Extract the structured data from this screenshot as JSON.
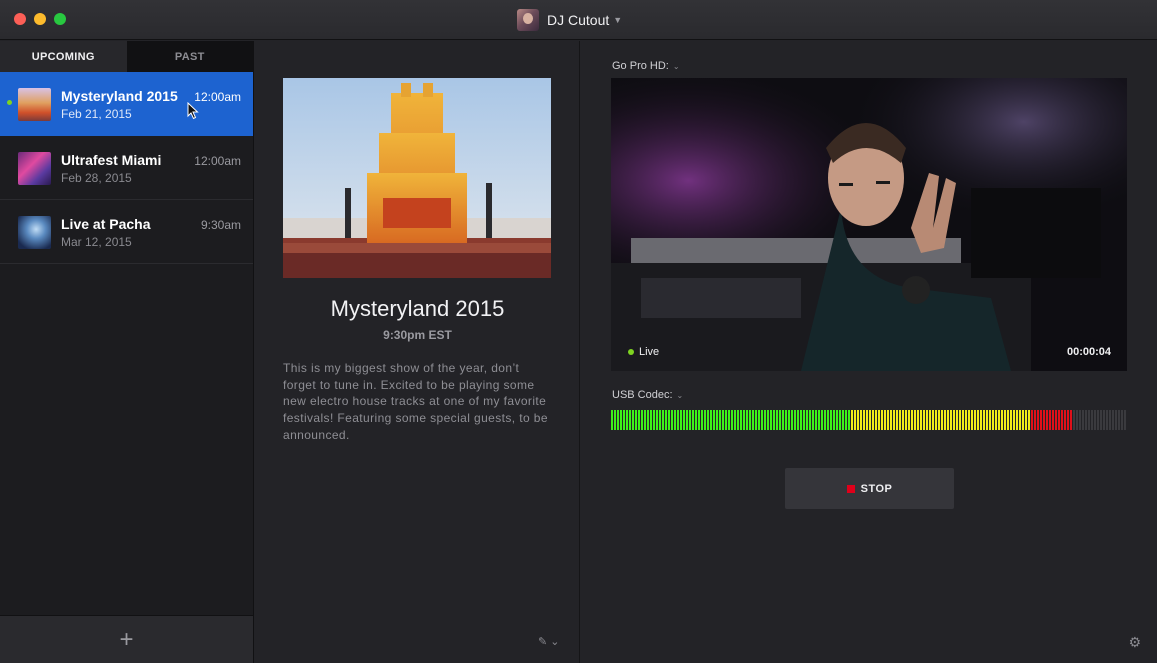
{
  "titlebar": {
    "profile_name": "DJ Cutout",
    "caret_icon": "chevron-down-icon"
  },
  "sidebar": {
    "tabs": [
      {
        "label": "UPCOMING",
        "selected": true
      },
      {
        "label": "PAST",
        "selected": false
      }
    ],
    "events": [
      {
        "title": "Mysteryland 2015",
        "date": "Feb 21, 2015",
        "time": "12:00am",
        "selected": true,
        "live": true
      },
      {
        "title": "Ultrafest Miami",
        "date": "Feb 28, 2015",
        "time": "12:00am",
        "selected": false,
        "live": false
      },
      {
        "title": "Live at Pacha",
        "date": "Mar 12, 2015",
        "time": "9:30am",
        "selected": false,
        "live": false
      }
    ],
    "add_icon": "plus-icon",
    "add_glyph": "+"
  },
  "detail": {
    "title": "Mysteryland 2015",
    "time": "9:30pm EST",
    "description": "This is my biggest show of the year, don’t forget to tune in. Excited to be playing some new electro house tracks at one of my favorite festivals! Featuring some special guests, to be announced.",
    "edit_icon": "pencil-icon",
    "edit_glyph": "✎ ⌄"
  },
  "stream": {
    "video_source_label": "Go Pro HD:",
    "audio_source_label": "USB Codec:",
    "caret_glyph": "⌄",
    "live_label": "Live",
    "timer": "00:00:04",
    "stop_label": "STOP",
    "settings_icon": "gear-icon",
    "settings_glyph": "⚙",
    "audio_level": 0.89,
    "meter_zones": {
      "green_until": 0.46,
      "yellow_until": 0.81,
      "red_until": 0.89
    },
    "colors": {
      "green": "#3ef01a",
      "yellow": "#f2ee1a",
      "red": "#e0101a",
      "off": "#3a3a3e"
    }
  },
  "colors": {
    "accent": "#1d63d0",
    "live_dot": "#7ed321",
    "stop_red": "#e0001a"
  }
}
